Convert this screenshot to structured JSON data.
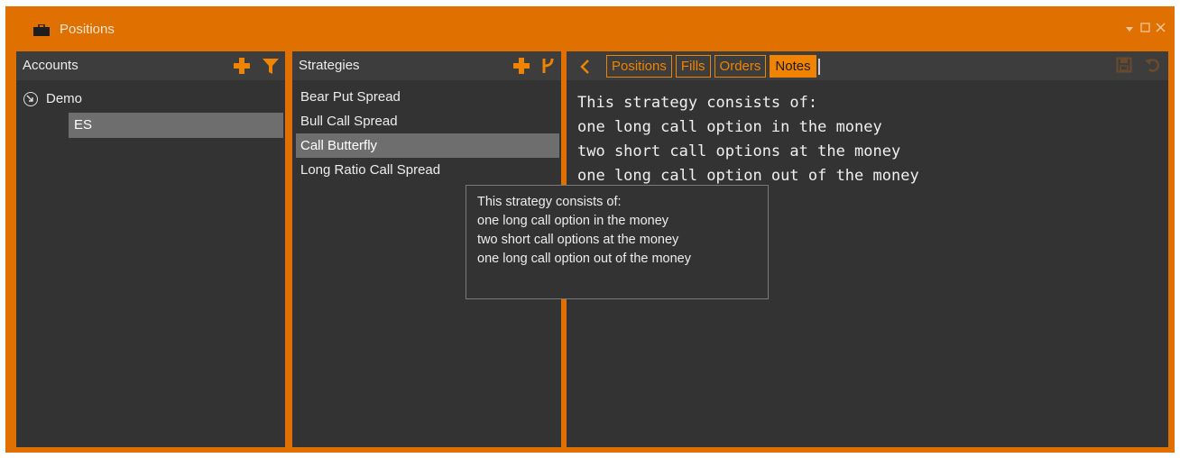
{
  "window": {
    "title": "Positions",
    "controls": [
      "dropdown-icon",
      "maximize-icon",
      "close-icon"
    ]
  },
  "accounts": {
    "title": "Accounts",
    "tree": [
      {
        "label": "Demo",
        "icon": "circle-arrow-icon",
        "children": [
          {
            "label": "ES",
            "selected": true
          }
        ]
      }
    ]
  },
  "strategies": {
    "title": "Strategies",
    "items": [
      {
        "label": "Bear Put Spread"
      },
      {
        "label": "Bull Call Spread"
      },
      {
        "label": "Call Butterfly",
        "selected": true
      },
      {
        "label": "Long Ratio Call Spread"
      }
    ]
  },
  "details": {
    "tabs": [
      {
        "label": "Positions"
      },
      {
        "label": "Fills"
      },
      {
        "label": "Orders"
      },
      {
        "label": "Notes",
        "active": true
      }
    ],
    "notes_lines": [
      "This strategy consists of:",
      "one long call option in the money",
      "two short call options at the money",
      "one long call option out of the money"
    ]
  },
  "tooltip": {
    "lines": [
      "This strategy consists of:",
      "one long call option in the money",
      "two short call options at the money",
      "one long call option out of the money"
    ]
  },
  "colors": {
    "accent": "#f08400",
    "frame": "#e07000",
    "panel": "#333333",
    "header": "#3d3d3d",
    "selection": "#6e6e6e"
  }
}
